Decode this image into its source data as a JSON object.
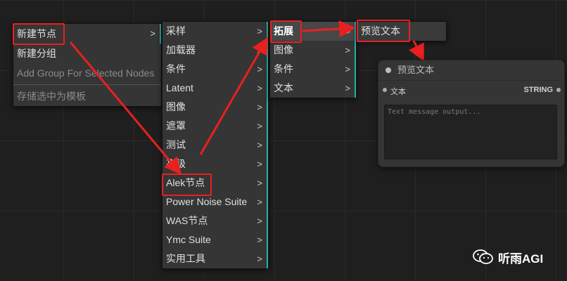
{
  "menu1": {
    "items": [
      {
        "label": "新建节点",
        "arrow": ">"
      },
      {
        "label": "新建分组"
      },
      {
        "label": "Add Group For Selected Nodes"
      },
      {
        "label": "存储选中为模板"
      }
    ]
  },
  "menu2": {
    "items": [
      {
        "label": "采样",
        "arrow": ">"
      },
      {
        "label": "加载器",
        "arrow": ">"
      },
      {
        "label": "条件",
        "arrow": ">"
      },
      {
        "label": "Latent",
        "arrow": ">"
      },
      {
        "label": "图像",
        "arrow": ">"
      },
      {
        "label": "遮罩",
        "arrow": ">"
      },
      {
        "label": "测试",
        "arrow": ">"
      },
      {
        "label": "高级",
        "arrow": ">"
      },
      {
        "label": "Alek节点",
        "arrow": ">"
      },
      {
        "label": "Power Noise Suite",
        "arrow": ">"
      },
      {
        "label": "WAS节点",
        "arrow": ">"
      },
      {
        "label": "Ymc Suite",
        "arrow": ">"
      },
      {
        "label": "实用工具",
        "arrow": ">"
      }
    ]
  },
  "menu3": {
    "items": [
      {
        "label": "拓展",
        "arrow": ">"
      },
      {
        "label": "图像",
        "arrow": ">"
      },
      {
        "label": "条件",
        "arrow": ">"
      },
      {
        "label": "文本",
        "arrow": ">"
      }
    ]
  },
  "menu4": {
    "items": [
      {
        "label": "预览文本"
      }
    ]
  },
  "node": {
    "title": "预览文本",
    "input_label": "文本",
    "output_label": "STRING",
    "text_placeholder": "Text message output..."
  },
  "watermark": {
    "text": "听雨AGI"
  },
  "colors": {
    "highlight": "#e82020",
    "accent": "#2ab0b0",
    "menu_bg": "#353535"
  }
}
